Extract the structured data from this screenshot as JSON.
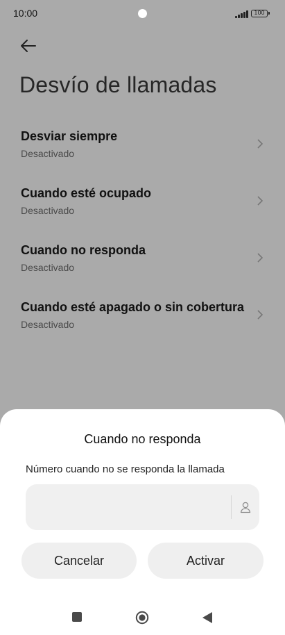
{
  "status_bar": {
    "time": "10:00",
    "battery": "100"
  },
  "header": {
    "title": "Desvío de llamadas"
  },
  "items": [
    {
      "title": "Desviar siempre",
      "status": "Desactivado"
    },
    {
      "title": "Cuando esté ocupado",
      "status": "Desactivado"
    },
    {
      "title": "Cuando no responda",
      "status": "Desactivado"
    },
    {
      "title": "Cuando esté apagado o sin cobertura",
      "status": "Desactivado"
    }
  ],
  "dialog": {
    "title": "Cuando no responda",
    "field_label": "Número cuando no se responda la llamada",
    "number_value": "",
    "cancel_label": "Cancelar",
    "activate_label": "Activar"
  },
  "icons": [
    "back-arrow-icon",
    "chevron-right-icon",
    "contact-icon",
    "recents-icon",
    "home-icon",
    "nav-back-icon"
  ]
}
